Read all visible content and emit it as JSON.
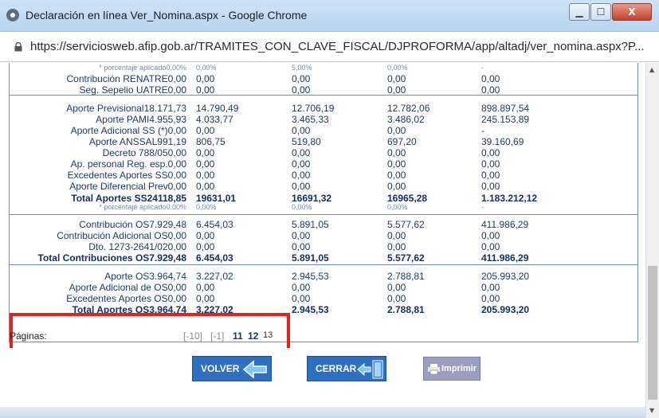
{
  "window": {
    "title": "Declaración en línea Ver_Nomina.aspx - Google Chrome",
    "buttons": {
      "minimize": "▁",
      "maximize": "☐",
      "close": "X"
    }
  },
  "address_bar": {
    "url": "https://serviciosweb.afip.gob.ar/TRAMITES_CON_CLAVE_FISCAL/DJPROFORMA/app/altadj/ver_nomina.aspx?P..."
  },
  "table": {
    "rows": [
      {
        "label": "* porcentaje aplicado",
        "v0": "0,00%",
        "c1": "0,00%",
        "c2": "5,00%",
        "c3": "0,00%",
        "c4": "-",
        "style": "small"
      },
      {
        "label": "Contribución RENATRE",
        "v0": "0,00",
        "c1": "0,00",
        "c2": "0,00",
        "c3": "0,00",
        "c4": "0,00"
      },
      {
        "label": "Seg. Sepelio UATRE",
        "v0": "0,00",
        "c1": "0,00",
        "c2": "0,00",
        "c3": "0,00",
        "c4": "0,00"
      },
      {
        "label": "Aporte Previsional",
        "v0": "18.171,73",
        "c1": "14.790,49",
        "c2": "12.706,19",
        "c3": "12.782,06",
        "c4": "898.897,54"
      },
      {
        "label": "Aporte PAMI",
        "v0": "4.955,93",
        "c1": "4.033,77",
        "c2": "3.465,33",
        "c3": "3.486,02",
        "c4": "245.153,89"
      },
      {
        "label": "Aporte Adicional SS (*)",
        "v0": "0,00",
        "c1": "0,00",
        "c2": "0,00",
        "c3": "0,00",
        "c4": "-"
      },
      {
        "label": "Aporte ANSSAL",
        "v0": "991,19",
        "c1": "806,75",
        "c2": "519,80",
        "c3": "697,20",
        "c4": "39.160,69"
      },
      {
        "label": "Decreto 788/05",
        "v0": "0,00",
        "c1": "0,00",
        "c2": "0,00",
        "c3": "0,00",
        "c4": "0,00"
      },
      {
        "label": "Ap. personal Reg. esp.",
        "v0": "0,00",
        "c1": "0,00",
        "c2": "0,00",
        "c3": "0,00",
        "c4": "0,00"
      },
      {
        "label": "Excedentes Aportes SS",
        "v0": "0,00",
        "c1": "0,00",
        "c2": "0,00",
        "c3": "0,00",
        "c4": "0,00"
      },
      {
        "label": "Aporte Diferencial Prev",
        "v0": "0,00",
        "c1": "0,00",
        "c2": "0,00",
        "c3": "0,00",
        "c4": "0,00"
      },
      {
        "label": "Total Aportes SS",
        "v0": "24118,85",
        "c1": "19631,01",
        "c2": "16691,32",
        "c3": "16965,28",
        "c4": "1.183.212,12",
        "style": "bold"
      },
      {
        "label": "* porcentaje aplicado",
        "v0": "0,00%",
        "c1": "0,00%",
        "c2": "0,00%",
        "c3": "0,00%",
        "c4": "-",
        "style": "small"
      },
      {
        "label": "Contribución OS",
        "v0": "7.929,48",
        "c1": "6.454,03",
        "c2": "5.891,05",
        "c3": "5.577,62",
        "c4": "411.986,29"
      },
      {
        "label": "Contribución Adicional OS",
        "v0": "0,00",
        "c1": "0,00",
        "c2": "0,00",
        "c3": "0,00",
        "c4": "0,00"
      },
      {
        "label": "Dto. 1273-2641/02",
        "v0": "0,00",
        "c1": "0,00",
        "c2": "0,00",
        "c3": "0,00",
        "c4": "0,00"
      },
      {
        "label": "Total Contribuciones OS",
        "v0": "7.929,48",
        "c1": "6.454,03",
        "c2": "5.891,05",
        "c3": "5.577,62",
        "c4": "411.986,29",
        "style": "bold"
      },
      {
        "label": "Aporte OS",
        "v0": "3.964,74",
        "c1": "3.227,02",
        "c2": "2.945,53",
        "c3": "2.788,81",
        "c4": "205.993,20"
      },
      {
        "label": "Aporte Adicional de OS",
        "v0": "0,00",
        "c1": "0,00",
        "c2": "0,00",
        "c3": "0,00",
        "c4": "0,00"
      },
      {
        "label": "Excedentes Aportes OS",
        "v0": "0,00",
        "c1": "0,00",
        "c2": "0,00",
        "c3": "0,00",
        "c4": "0,00"
      },
      {
        "label": "Total Aportes OS",
        "v0": "3.964,74",
        "c1": "3.227,02",
        "c2": "2.945,53",
        "c3": "2.788,81",
        "c4": "205.993,20",
        "style": "bold"
      }
    ]
  },
  "pagination": {
    "label": "Páginas:",
    "items": [
      {
        "text": "[-10]",
        "kind": "dim"
      },
      {
        "text": "[-1]",
        "kind": "dim"
      },
      {
        "text": "11",
        "kind": "link"
      },
      {
        "text": "12",
        "kind": "link"
      },
      {
        "text": "13",
        "kind": "current"
      }
    ]
  },
  "buttons": {
    "volver": "VOLVER",
    "cerrar": "CERRAR",
    "imprimir": "Imprimir"
  },
  "colors": {
    "highlight_box": "#e8201e",
    "button_blue": "#2f6fbf",
    "table_text": "#1f3a6b"
  },
  "icons": [
    "globe-icon",
    "lock-icon",
    "back-arrow-icon",
    "exit-door-icon",
    "print-icon"
  ]
}
